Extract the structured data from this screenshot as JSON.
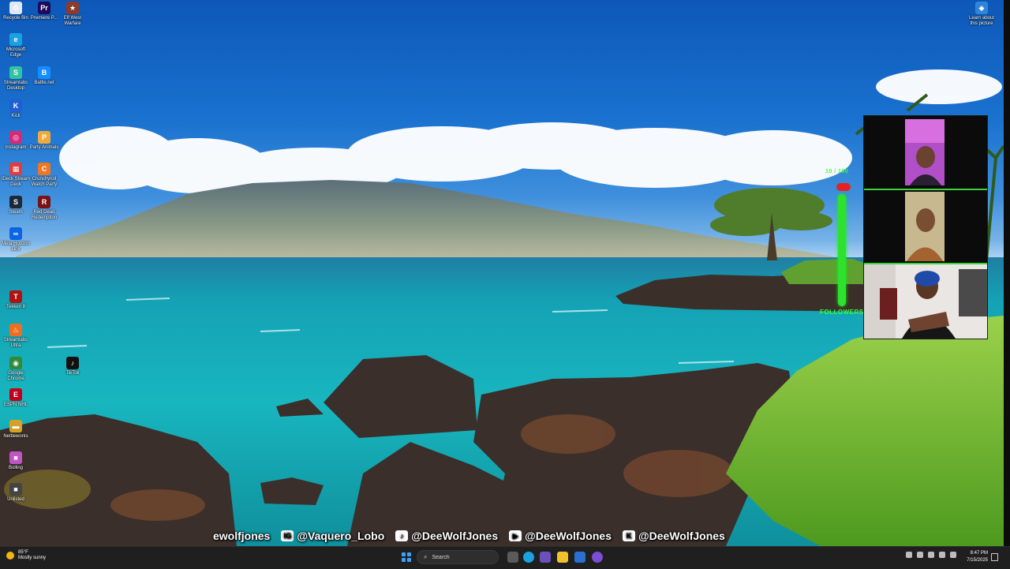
{
  "desktop": {
    "top_icons": [
      {
        "label": "Recycle Bin",
        "icon": "recycle-bin-icon",
        "color": "#dfe8f5"
      },
      {
        "label": "Premiere P...",
        "icon": "premiere-pro-icon",
        "color": "#1d0a5c"
      },
      {
        "label": "Elf West Warfare",
        "icon": "game-icon",
        "color": "#8a3b2b"
      }
    ],
    "left_icons": [
      {
        "label": "Microsoft Edge",
        "icon": "edge-icon",
        "color": "#1ba1e2"
      },
      {
        "label": "Streamlabs Desktop",
        "icon": "streamlabs-icon",
        "color": "#31c3a2"
      },
      {
        "label": "Battle.net",
        "icon": "battlenet-icon",
        "color": "#148eff"
      },
      {
        "label": "Kick",
        "icon": "kick-icon",
        "color": "#1f5fd6"
      },
      {
        "label": "Instagram",
        "icon": "instagram-icon",
        "color": "#d62976"
      },
      {
        "label": "Party Animals",
        "icon": "party-animals-icon",
        "color": "#f2a93b"
      },
      {
        "label": "iDeck Stream Deck",
        "icon": "stream-deck-icon",
        "color": "#e43b3b"
      },
      {
        "label": "Crunchyroll Watch Party",
        "icon": "crunchyroll-icon",
        "color": "#f47521"
      },
      {
        "label": "Steam",
        "icon": "steam-icon",
        "color": "#1b2838"
      },
      {
        "label": "Red Dead Redemption",
        "icon": "rdr-icon",
        "color": "#7a1212"
      },
      {
        "label": "Meta Horizon Link",
        "icon": "meta-icon",
        "color": "#0a64e6"
      },
      {
        "label": "Tekken 8",
        "icon": "tekken-icon",
        "color": "#b01212"
      },
      {
        "label": "Streamlabs Ultra",
        "icon": "flame-icon",
        "color": "#ef6d20"
      },
      {
        "label": "TikTok",
        "icon": "tiktok-icon",
        "color": "#111111"
      },
      {
        "label": "Google Chrome",
        "icon": "chrome-icon",
        "color": "#2e8b3a"
      },
      {
        "label": "ESPN NHL",
        "icon": "espn-icon",
        "color": "#c0001a"
      },
      {
        "label": "Nettleworks",
        "icon": "folder-icon",
        "color": "#d7a129"
      },
      {
        "label": "Bolling",
        "icon": "app-icon",
        "color": "#c255c6"
      },
      {
        "label": "Unlisted",
        "icon": "app-icon",
        "color": "#444444"
      }
    ],
    "learn_about": {
      "label": "Learn about this picture",
      "icon": "learn-about-icon"
    }
  },
  "overlay": {
    "goal_top": "10 / 100",
    "goal_label": "FOLLOWERS",
    "accent": "#38ff38",
    "socials": [
      {
        "icon": "",
        "text": "ewolfjones",
        "name": "social-handle-partial"
      },
      {
        "icon": "IG",
        "text": "@Vaquero_Lobo",
        "name": "social-instagram"
      },
      {
        "icon": "♪",
        "text": "@DeeWolfJones",
        "name": "social-tiktok"
      },
      {
        "icon": "▶",
        "text": "@DeeWolfJones",
        "name": "social-youtube"
      },
      {
        "icon": "K",
        "text": "@DeeWolfJones",
        "name": "social-kick"
      }
    ]
  },
  "taskbar": {
    "weather_temp": "85°F",
    "weather_desc": "Mostly sunny",
    "search_placeholder": "Search",
    "time": "8:47 PM",
    "date": "7/15/2025"
  }
}
